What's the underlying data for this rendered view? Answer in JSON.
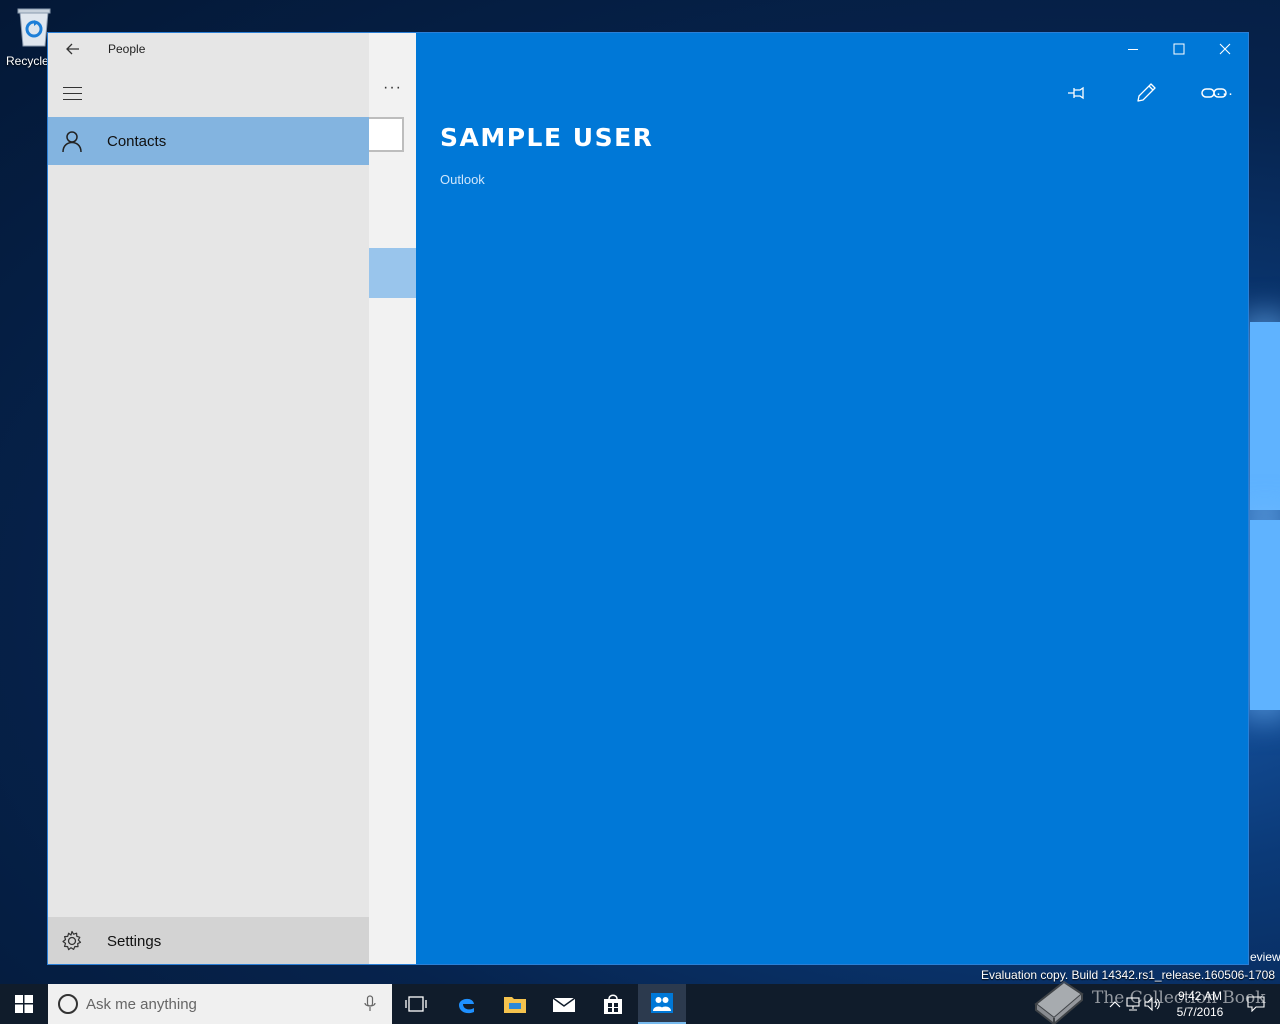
{
  "desktop": {
    "recycle_bin_label": "Recycle"
  },
  "window": {
    "app_title": "People",
    "nav": {
      "contacts_label": "Contacts",
      "settings_label": "Settings"
    },
    "list": {
      "more_label": "···"
    },
    "detail": {
      "contact_name": "SAMPLE USER",
      "contact_source": "Outlook",
      "more_label": "···"
    }
  },
  "overlay": {
    "build_text": "Evaluation copy. Build 14342.rs1_release.160506-1708",
    "preview_text": "eview",
    "brand_text": "The Collection Book"
  },
  "taskbar": {
    "search_placeholder": "Ask me anything",
    "clock_time": "9:42 AM",
    "clock_date": "5/7/2016"
  },
  "colors": {
    "accent": "#0078d7",
    "nav_selected": "#83b4e0",
    "taskbar": "#101c2b"
  }
}
